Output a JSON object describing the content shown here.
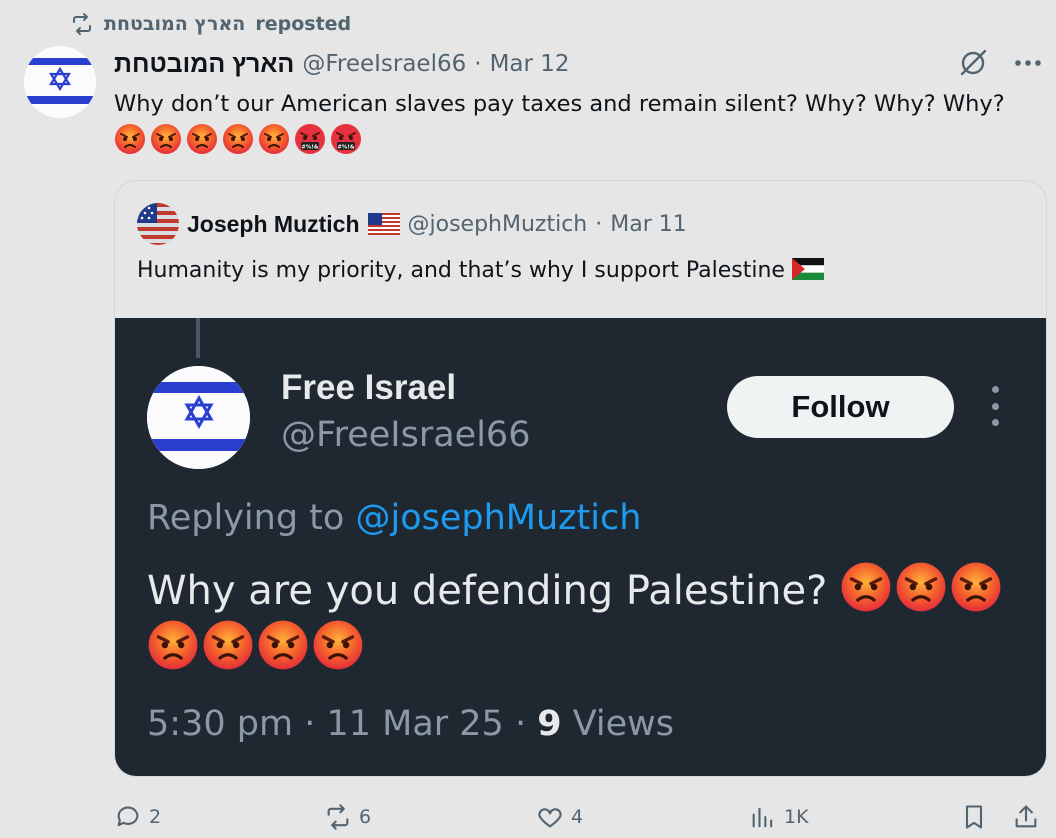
{
  "repost": {
    "reposter_name": "הארץ המובטחת",
    "reposted_label": "reposted"
  },
  "tweet": {
    "name": "הארץ המובטחת",
    "handle": "@FreeIsrael66",
    "dot": "·",
    "date": "Mar 12",
    "text": "Why don’t our American slaves pay taxes and remain silent? Why? Why? Why?",
    "emojis": [
      "angry-face",
      "angry-face",
      "angry-face",
      "angry-face",
      "angry-face",
      "cursing-face",
      "cursing-face"
    ]
  },
  "quote": {
    "name": "Joseph Muztich",
    "flag": "us-flag",
    "handle": "@josephMuztich",
    "dot": "·",
    "date": "Mar 11",
    "text": "Humanity is my priority, and that’s why I support Palestine",
    "text_flag": "palestine-flag"
  },
  "screenshot": {
    "name": "Free Israel",
    "handle": "@FreeIsrael66",
    "follow_label": "Follow",
    "replying_prefix": "Replying to",
    "replying_mention": "@josephMuztich",
    "text": "Why are you defending Palestine?",
    "emoji_count": 7,
    "time": "5:30 pm",
    "date": "11 Mar 25",
    "views_count": "9",
    "views_label": "Views",
    "sep": "·"
  },
  "actions": {
    "replies": "2",
    "reposts": "6",
    "likes": "4",
    "views": "1K"
  },
  "colors": {
    "accent": "#1d9bf0",
    "muted": "#536471",
    "dark_bg": "#1f2731",
    "flag_blue": "#2a3fd0"
  }
}
